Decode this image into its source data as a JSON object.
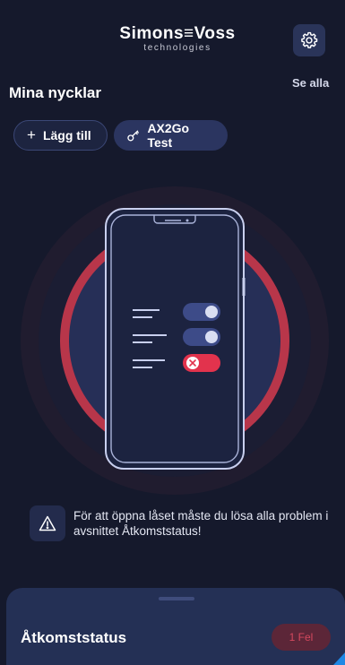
{
  "header": {
    "brand_main": "Simons≡Voss",
    "brand_sub": "technologies",
    "settings_icon": "gear-icon"
  },
  "keys": {
    "title": "Mina nycklar",
    "see_all": "Se alla",
    "add_label": "Lägg till",
    "add_icon": "plus-icon",
    "key_label": "AX2Go Test",
    "key_icon": "key-icon"
  },
  "illustration": {
    "toggles": [
      {
        "state": "on"
      },
      {
        "state": "on"
      },
      {
        "state": "error"
      }
    ],
    "colors": {
      "ring": "#b8364a",
      "toggle_on": "#3d4b88",
      "toggle_error": "#e2334d"
    }
  },
  "warning": {
    "icon": "warning-triangle-icon",
    "text": "För att öppna låset måste du lösa alla problem i avsnittet Åtkomststatus!"
  },
  "access_status": {
    "title": "Åtkomststatus",
    "badge": "1 Fel",
    "badge_color": "#d3485e"
  }
}
